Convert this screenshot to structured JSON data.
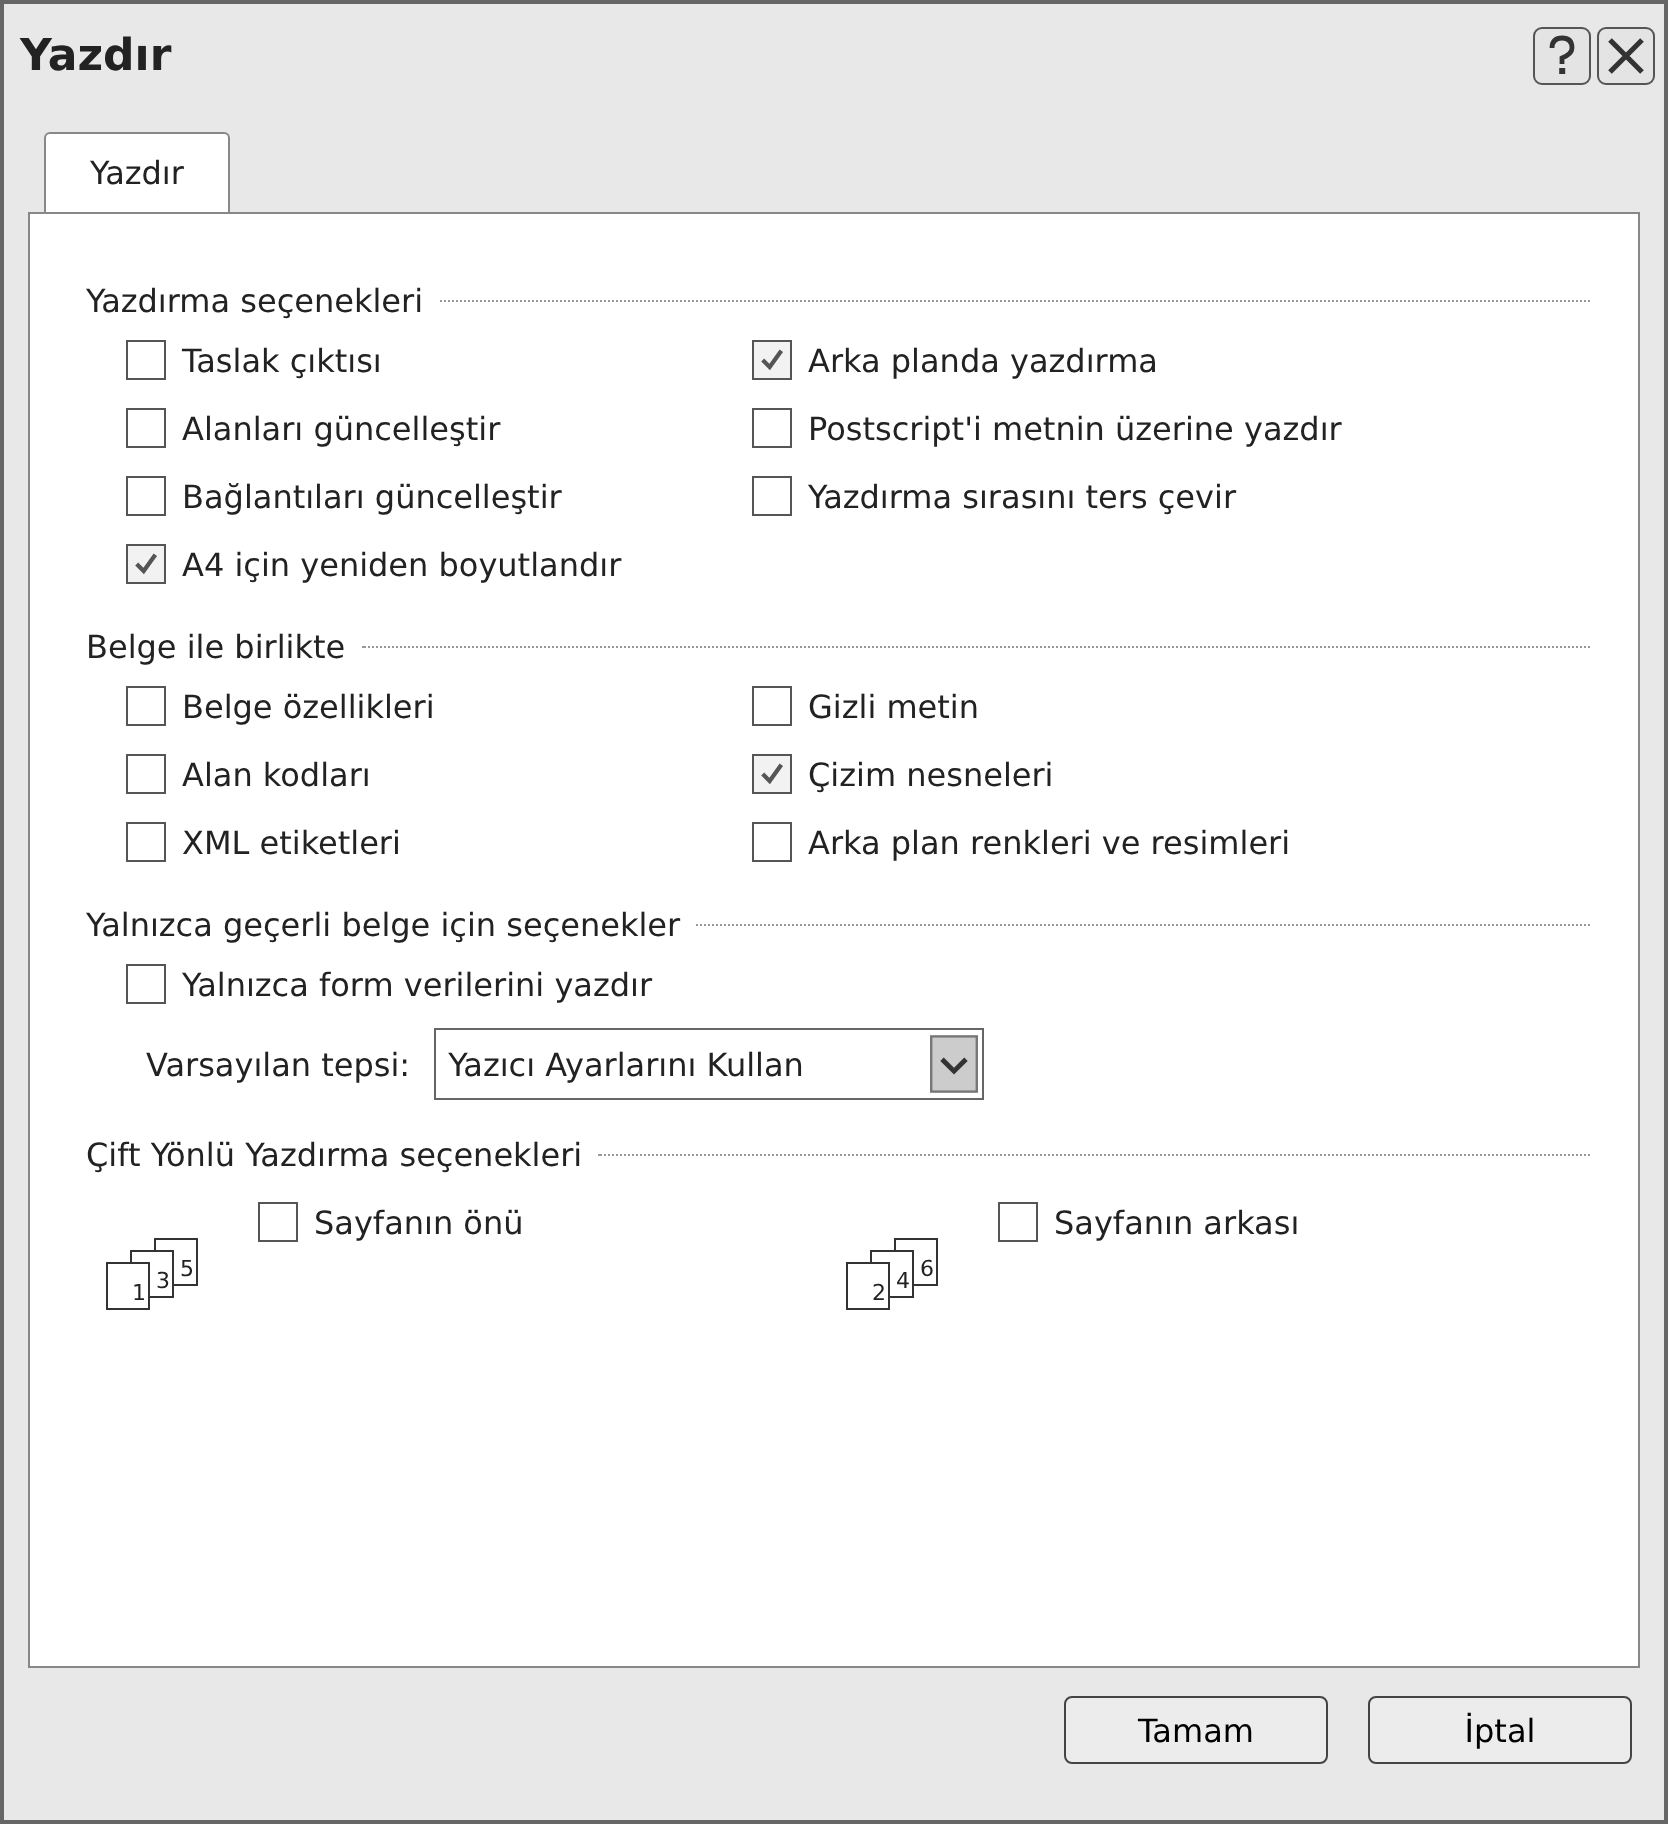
{
  "window": {
    "title": "Yazdır"
  },
  "tabs": [
    {
      "label": "Yazdır",
      "selected": true
    }
  ],
  "sections": [
    {
      "title": "Yazdırma seçenekleri",
      "options": [
        {
          "label": "Taslak çıktısı",
          "checked": false
        },
        {
          "label": "Arka planda yazdırma",
          "checked": true
        },
        {
          "label": "Alanları güncelleştir",
          "checked": false
        },
        {
          "label": "Postscript'i metnin üzerine yazdır",
          "checked": false
        },
        {
          "label": "Bağlantıları güncelleştir",
          "checked": false
        },
        {
          "label": "Yazdırma sırasını ters çevir",
          "checked": false
        },
        {
          "label": "A4 için yeniden boyutlandır",
          "checked": true
        }
      ]
    },
    {
      "title": "Belge ile birlikte",
      "options": [
        {
          "label": "Belge özellikleri",
          "checked": false
        },
        {
          "label": "Gizli metin",
          "checked": false
        },
        {
          "label": "Alan kodları",
          "checked": false
        },
        {
          "label": "Çizim nesneleri",
          "checked": true
        },
        {
          "label": "XML etiketleri",
          "checked": false
        },
        {
          "label": "Arka plan renkleri ve resimleri",
          "checked": false
        }
      ]
    },
    {
      "title": "Yalnızca geçerli belge için seçenekler",
      "options": [
        {
          "label": "Yalnızca form verilerini yazdır",
          "checked": false
        }
      ],
      "tray": {
        "label": "Varsayılan tepsi:",
        "value": "Yazıcı Ayarlarını Kullan"
      }
    }
  ],
  "duplex": {
    "title": "Çift Yönlü Yazdırma seçenekleri",
    "items": [
      {
        "pages": [
          "1",
          "3",
          "5"
        ],
        "label": "Sayfanın önü",
        "checked": false
      },
      {
        "pages": [
          "2",
          "4",
          "6"
        ],
        "label": "Sayfanın arkası",
        "checked": false
      }
    ]
  },
  "buttons": [
    "Tamam",
    "İptal"
  ]
}
